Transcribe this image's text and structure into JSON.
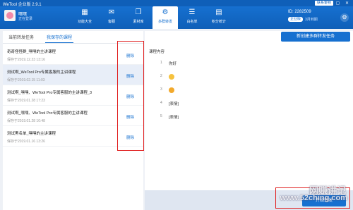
{
  "window": {
    "app_title": "WeTool 企业版 2.9.1",
    "contact_label": "联系客服",
    "win_buttons": "— ▢ ✕"
  },
  "user": {
    "name": "嘿嘿",
    "status": "正在登录"
  },
  "nav": [
    {
      "label": "功能大全",
      "icon": "grid-icon",
      "glyph": "▦"
    },
    {
      "label": "客服",
      "icon": "chat-icon",
      "glyph": "✉"
    },
    {
      "label": "素材库",
      "icon": "library-icon",
      "glyph": "❐"
    },
    {
      "label": "多群转发",
      "icon": "share-icon",
      "glyph": "⚙",
      "active": true
    },
    {
      "label": "白名单",
      "icon": "whitelist-icon",
      "glyph": "☰"
    },
    {
      "label": "积分统计",
      "icon": "stats-icon",
      "glyph": "▤"
    }
  ],
  "account": {
    "id": "ID: 2282509",
    "badge": "企业版",
    "count": "3月到期"
  },
  "tabs": {
    "current": "当前转发任务",
    "saved": "我保存的课程"
  },
  "courses": [
    {
      "name": "奇奇怪怪群_嘿嘿的主讲课程",
      "saved": "保存于2019.12.23 13:16",
      "delete": "删除"
    },
    {
      "name": "测试啊_WeTool Pro专属客服的主讲课程",
      "saved": "保存于2019.02.15 11:03",
      "delete": "删除"
    },
    {
      "name": "测试啊_嘿嘿、WeTool Pro专属客服的主讲课程_3",
      "saved": "保存于2019.01.28 17:23",
      "delete": "删除"
    },
    {
      "name": "测试啊_嘿嘿、WeTool Pro专属客服的主讲课程",
      "saved": "保存于2019.01.28 10:48",
      "delete": "删除"
    },
    {
      "name": "测试黑名单_嘿嘿的主讲课程",
      "saved": "保存于2019.01.16 13:26",
      "delete": "删除"
    }
  ],
  "right": {
    "new_task": "新创建多群转发任务",
    "content_title": "课程内容",
    "send_label": "开始转发"
  },
  "lessons": [
    {
      "num": "1",
      "text": "你好",
      "emoji": ""
    },
    {
      "num": "2",
      "text": "",
      "emoji": "sun"
    },
    {
      "num": "3",
      "text": "",
      "emoji": "face"
    },
    {
      "num": "4",
      "text": "[表情]",
      "emoji": ""
    },
    {
      "num": "5",
      "text": "[表情]",
      "emoji": ""
    }
  ],
  "watermark": {
    "line1": "网赚讲记",
    "line2": "www.52ching.com"
  },
  "colors": {
    "brand": "#1670d0",
    "highlight": "#e02020"
  }
}
